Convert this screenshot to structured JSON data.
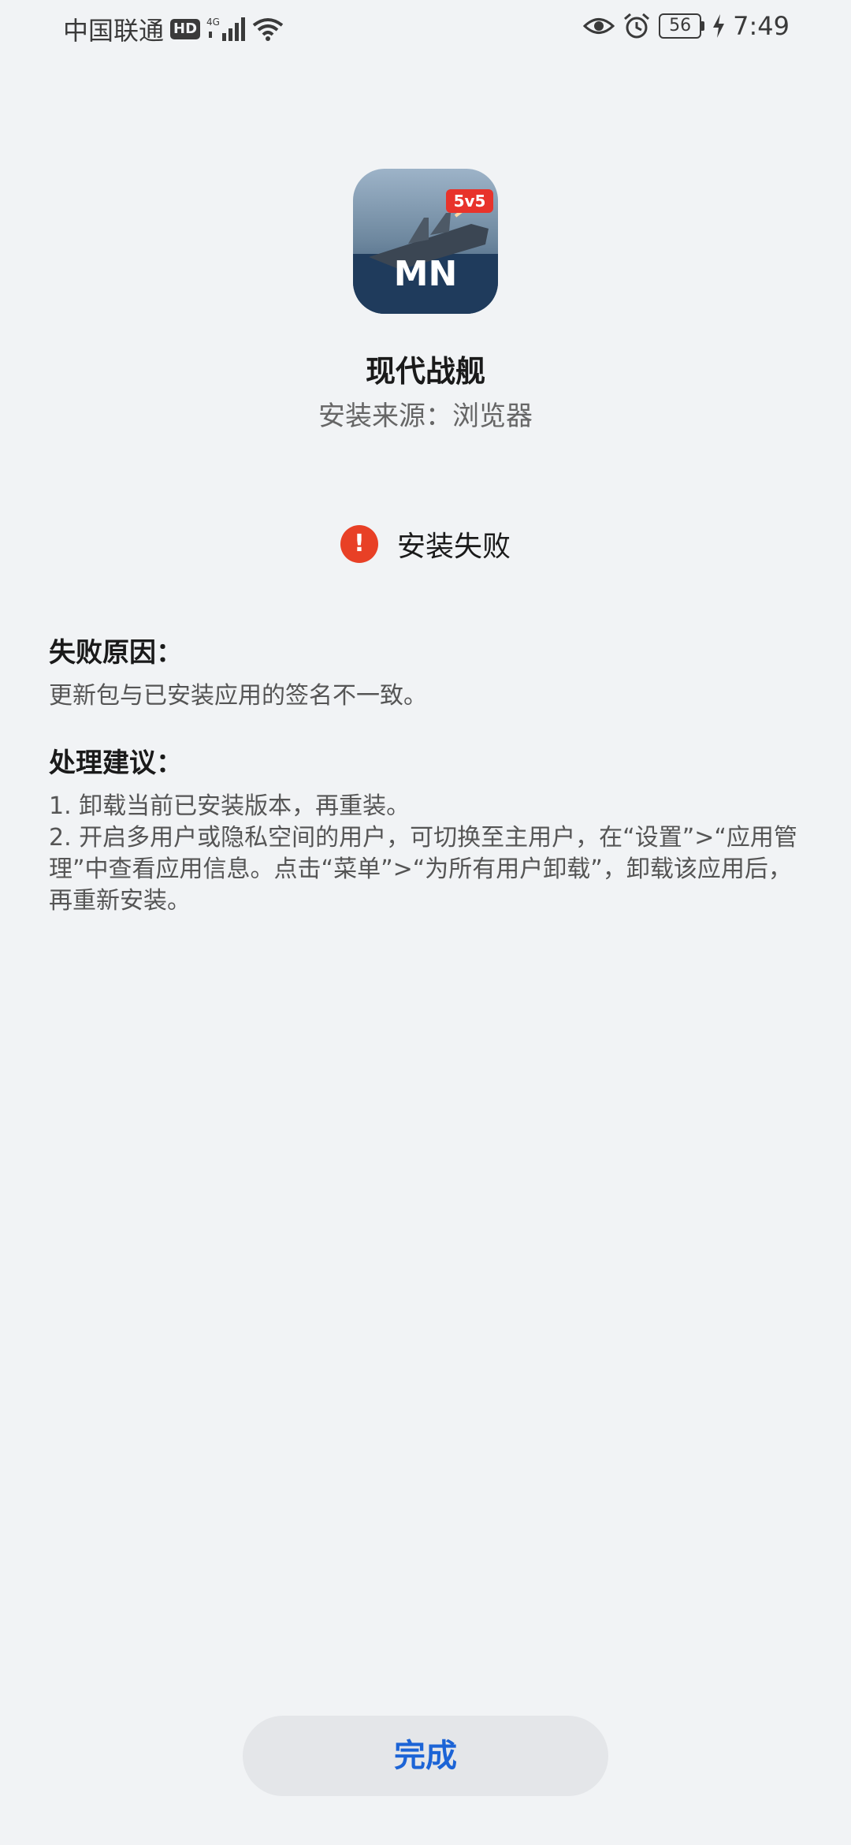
{
  "status_bar": {
    "carrier": "中国联通",
    "hd": "HD",
    "network": "4G",
    "battery": "56",
    "time": "7:49",
    "icons": [
      "signal-icon",
      "wifi-icon",
      "eye-icon",
      "alarm-icon",
      "battery-icon",
      "charging-icon"
    ]
  },
  "app": {
    "name": "现代战舰",
    "source": "安装来源：浏览器",
    "icon_badge": "5v5",
    "icon_text": "MN"
  },
  "status": {
    "text": "安装失败",
    "icon": "!",
    "color": "#e84026"
  },
  "reason": {
    "title": "失败原因：",
    "body": "更新包与已安装应用的签名不一致。"
  },
  "advice": {
    "title": "处理建议：",
    "items": [
      "1. 卸载当前已安装版本，再重装。",
      "2. 开启多用户或隐私空间的用户，可切换至主用户，在“设置”>“应用管理”中查看应用信息。点击“菜单”>“为所有用户卸载”，卸载该应用后，再重新安装。"
    ]
  },
  "actions": {
    "done": "完成",
    "accent": "#1c64d6"
  }
}
